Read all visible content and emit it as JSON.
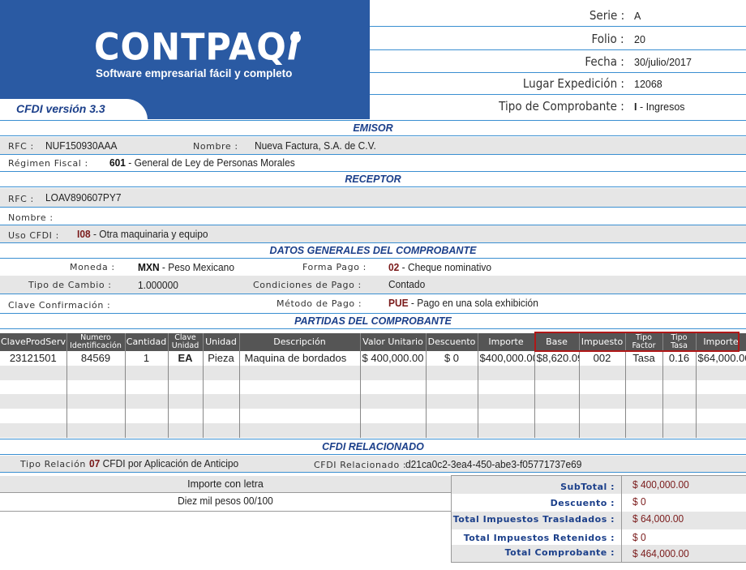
{
  "header": {
    "logo_text": "CONTPAQ",
    "logo_suffix": "i",
    "tagline": "Software empresarial fácil y completo",
    "version": "CFDI versión 3.3",
    "serie_label": "Serie :",
    "serie": "A",
    "folio_label": "Folio :",
    "folio": "20",
    "fecha_label": "Fecha :",
    "fecha": "30/julio/2017",
    "lugar_label": "Lugar Expedición :",
    "lugar": "12068",
    "tipo_label": "Tipo de Comprobante :",
    "tipo_code": "I",
    "tipo": "- Ingresos"
  },
  "emisor": {
    "title": "EMISOR",
    "rfc_label": "RFC :",
    "rfc": "NUF150930AAA",
    "nombre_label": "Nombre :",
    "nombre": "Nueva Factura, S.A. de C.V.",
    "regimen_label": "Régimen Fiscal :",
    "regimen_code": "601",
    "regimen": "- General de Ley de Personas Morales"
  },
  "receptor": {
    "title": "RECEPTOR",
    "rfc_label": "RFC :",
    "rfc": "LOAV890607PY7",
    "nombre_label": "Nombre :",
    "uso_label": "Uso CFDI :",
    "uso_code": "I08",
    "uso": "- Otra maquinaria y equipo"
  },
  "datos": {
    "title": "DATOS GENERALES DEL COMPROBANTE",
    "moneda_label": "Moneda :",
    "moneda_code": "MXN",
    "moneda": "- Peso Mexicano",
    "forma_label": "Forma Pago :",
    "forma_code": "02",
    "forma": "- Cheque nominativo",
    "tipo_cambio_label": "Tipo de Cambio :",
    "tipo_cambio": "1.000000",
    "condiciones_label": "Condiciones de Pago :",
    "condiciones": "Contado",
    "clave_label": "Clave Confirmación :",
    "metodo_label": "Método de Pago :",
    "metodo_code": "PUE",
    "metodo": "- Pago en una sola exhibición"
  },
  "partidas": {
    "title": "PARTIDAS DEL COMPROBANTE",
    "columns": [
      "ClaveProdServ",
      "Numero Identificación",
      "Cantidad",
      "Clave Unidad",
      "Unidad",
      "Descripción",
      "Valor Unitario",
      "Descuento",
      "Importe",
      "Base",
      "Impuesto",
      "Tipo Factor",
      "Tipo Tasa",
      "Importe"
    ],
    "rows": [
      [
        "23121501",
        "84569",
        "1",
        "EA",
        "Pieza",
        "Maquina de bordados",
        "$ 400,000.00",
        "$ 0",
        "$400,000.00",
        "$8,620.09",
        "002",
        "Tasa",
        "0.16",
        "$64,000.00"
      ]
    ]
  },
  "relacionado": {
    "title": "CFDI RELACIONADO",
    "tipo_label": "Tipo Relación :",
    "tipo_code": "07",
    "tipo": "CFDI por Aplicación de Anticipo",
    "cfdi_label": "CFDI Relacionado :",
    "cfdi": "d21ca0c2-3ea4-450-abe3-f05771737e69"
  },
  "importe_letra": {
    "label": "Importe con letra",
    "value": "Diez mil pesos 00/100"
  },
  "totales": {
    "subtotal_label": "SubTotal :",
    "subtotal": "$ 400,000.00",
    "descuento_label": "Descuento :",
    "descuento": "$ 0",
    "trasladados_label": "Total Impuestos Trasladados :",
    "trasladados": "$ 64,000.00",
    "retenidos_label": "Total Impuestos Retenidos :",
    "retenidos": "$ 0",
    "total_label": "Total Comprobante :",
    "total": "$  464,000.00"
  },
  "colors": {
    "brand_blue": "#2a5aa3",
    "section_title": "#1b3f8a",
    "code_red": "#7a1a1a",
    "highlight_border": "#b01818",
    "table_header": "#555555"
  }
}
